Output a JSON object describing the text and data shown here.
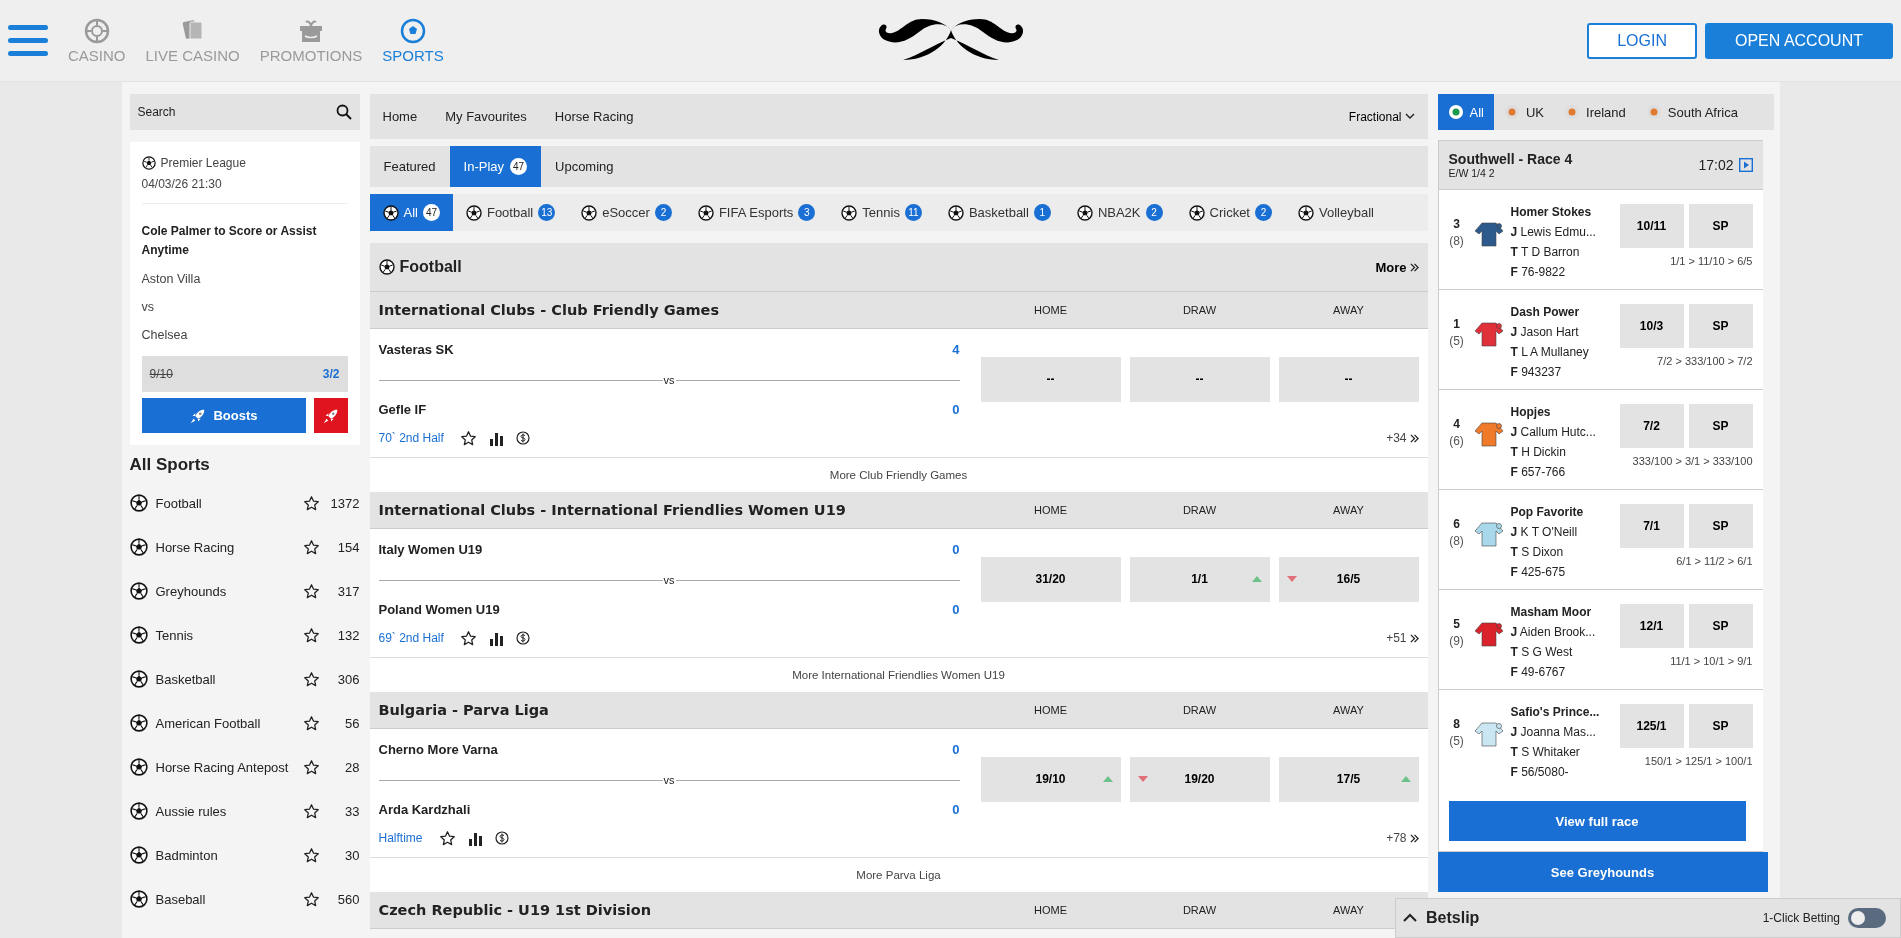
{
  "header": {
    "nav": [
      {
        "label": "CASINO",
        "selected": false
      },
      {
        "label": "LIVE CASINO",
        "selected": false
      },
      {
        "label": "PROMOTIONS",
        "selected": false
      },
      {
        "label": "SPORTS",
        "selected": true
      }
    ],
    "login": "LOGIN",
    "open_account": "OPEN ACCOUNT"
  },
  "sidebar": {
    "search": {
      "placeholder": "Search"
    },
    "boost": {
      "league": "Premier League",
      "datetime": "04/03/26 21:30",
      "title": "Cole Palmer to Score or Assist Anytime",
      "home": "Aston Villa",
      "vs": "vs",
      "away": "Chelsea",
      "old_odds": "9/10",
      "new_odds": "3/2",
      "button": "Boosts"
    },
    "heading": "All Sports",
    "sports": [
      {
        "name": "Football",
        "count": "1372"
      },
      {
        "name": "Horse Racing",
        "count": "154"
      },
      {
        "name": "Greyhounds",
        "count": "317"
      },
      {
        "name": "Tennis",
        "count": "132"
      },
      {
        "name": "Basketball",
        "count": "306"
      },
      {
        "name": "American Football",
        "count": "56"
      },
      {
        "name": "Horse Racing Antepost",
        "count": "28"
      },
      {
        "name": "Aussie rules",
        "count": "33"
      },
      {
        "name": "Badminton",
        "count": "30"
      },
      {
        "name": "Baseball",
        "count": "560"
      }
    ]
  },
  "main": {
    "top_nav": [
      "Home",
      "My Favourites",
      "Horse Racing"
    ],
    "odds_format": "Fractional",
    "tabs": [
      {
        "label": "Featured",
        "selected": false
      },
      {
        "label": "In-Play",
        "count": "47",
        "selected": true
      },
      {
        "label": "Upcoming",
        "selected": false
      }
    ],
    "sport_filters": [
      {
        "label": "All",
        "count": "47",
        "selected": true
      },
      {
        "label": "Football",
        "count": "13",
        "selected": false
      },
      {
        "label": "eSoccer",
        "count": "2",
        "selected": false
      },
      {
        "label": "FIFA Esports",
        "count": "3",
        "selected": false
      },
      {
        "label": "Tennis",
        "count": "11",
        "selected": false
      },
      {
        "label": "Basketball",
        "count": "1",
        "selected": false
      },
      {
        "label": "NBA2K",
        "count": "2",
        "selected": false
      },
      {
        "label": "Cricket",
        "count": "2",
        "selected": false
      },
      {
        "label": "Volleyball",
        "selected": false
      }
    ],
    "section": {
      "title": "Football",
      "more": "More"
    },
    "competitions": [
      {
        "title": "International Clubs - Club Friendly Games",
        "columns": [
          "HOME",
          "DRAW",
          "AWAY"
        ],
        "match": {
          "home": "Vasteras SK",
          "home_score": "4",
          "vs": "vs",
          "away": "Gefle IF",
          "away_score": "0",
          "status": "70` 2nd Half",
          "markets": "+34",
          "odds": [
            {
              "value": "--",
              "up": false,
              "down": false
            },
            {
              "value": "--",
              "up": false,
              "down": false
            },
            {
              "value": "--",
              "up": false,
              "down": false
            }
          ]
        },
        "more_link": "More Club Friendly Games"
      },
      {
        "title": "International Clubs - International Friendlies Women U19",
        "columns": [
          "HOME",
          "DRAW",
          "AWAY"
        ],
        "match": {
          "home": "Italy Women U19",
          "home_score": "0",
          "vs": "vs",
          "away": "Poland Women U19",
          "away_score": "0",
          "status": "69` 2nd Half",
          "markets": "+51",
          "odds": [
            {
              "value": "31/20",
              "up": false,
              "down": false
            },
            {
              "value": "1/1",
              "up": true,
              "down": false
            },
            {
              "value": "16/5",
              "up": false,
              "down": true
            }
          ]
        },
        "more_link": "More International Friendlies Women U19"
      },
      {
        "title": "Bulgaria - Parva Liga",
        "columns": [
          "HOME",
          "DRAW",
          "AWAY"
        ],
        "match": {
          "home": "Cherno More Varna",
          "home_score": "0",
          "vs": "vs",
          "away": "Arda Kardzhali",
          "away_score": "0",
          "status": "Halftime",
          "markets": "+78",
          "odds": [
            {
              "value": "19/10",
              "up": true,
              "down": false
            },
            {
              "value": "19/20",
              "up": false,
              "down": true
            },
            {
              "value": "17/5",
              "up": true,
              "down": false
            }
          ]
        },
        "more_link": "More Parva Liga"
      },
      {
        "title": "Czech Republic - U19 1st Division",
        "columns": [
          "HOME",
          "DRAW",
          "AWAY"
        ]
      }
    ]
  },
  "racing": {
    "regions": [
      {
        "label": "All",
        "selected": true
      },
      {
        "label": "UK",
        "selected": false
      },
      {
        "label": "Ireland",
        "selected": false
      },
      {
        "label": "South Africa",
        "selected": false
      }
    ],
    "race": {
      "title": "Southwell - Race 4",
      "terms": "E/W 1/4 2",
      "time": "17:02"
    },
    "runners": [
      {
        "number": "3",
        "draw": "(8)",
        "name": "Homer Stokes",
        "jockey": "**J** Lewis Edmu...",
        "trainer": "**T** T D Barron",
        "form": "**F** 76-9822",
        "odds": "10/11",
        "sp": "SP",
        "history": "1/1 > 11/10 > 6/5",
        "color": "#2d5a8c"
      },
      {
        "number": "1",
        "draw": "(5)",
        "name": "Dash Power",
        "jockey": "**J** Jason Hart",
        "trainer": "**T** L A Mullaney",
        "form": "**F** 943237",
        "odds": "10/3",
        "sp": "SP",
        "history": "7/2 > 333/100 > 7/2",
        "color": "#e0303a"
      },
      {
        "number": "4",
        "draw": "(6)",
        "name": "Hopjes",
        "jockey": "**J** Callum Hutc...",
        "trainer": "**T** H Dickin",
        "form": "**F** 657-766",
        "odds": "7/2",
        "sp": "SP",
        "history": "333/100 > 3/1 > 333/100",
        "color": "#ef7a2a"
      },
      {
        "number": "6",
        "draw": "(8)",
        "name": "Pop Favorite",
        "jockey": "**J** K T O'Neill",
        "trainer": "**T** S Dixon",
        "form": "**F** 425-675",
        "odds": "7/1",
        "sp": "SP",
        "history": "6/1 > 11/2 > 6/1",
        "color": "#a9d8ea"
      },
      {
        "number": "5",
        "draw": "(9)",
        "name": "Masham Moor",
        "jockey": "**J** Aiden Brook...",
        "trainer": "**T** S G West",
        "form": "**F** 49-6767",
        "odds": "12/1",
        "sp": "SP",
        "history": "11/1 > 10/1 > 9/1",
        "color": "#d9222a"
      },
      {
        "number": "8",
        "draw": "(5)",
        "name": "Safio's Prince...",
        "jockey": "**J** Joanna Mas...",
        "trainer": "**T** S Whitaker",
        "form": "**F** 56/5080-",
        "odds": "125/1",
        "sp": "SP",
        "history": "150/1 > 125/1 > 100/1",
        "color": "#c9e6f2"
      }
    ],
    "view_full_race": "View full race",
    "see_greyhounds": "See Greyhounds"
  },
  "betslip": {
    "title": "Betslip",
    "one_click": {
      "label": "1-Click Betting",
      "on": false
    }
  }
}
